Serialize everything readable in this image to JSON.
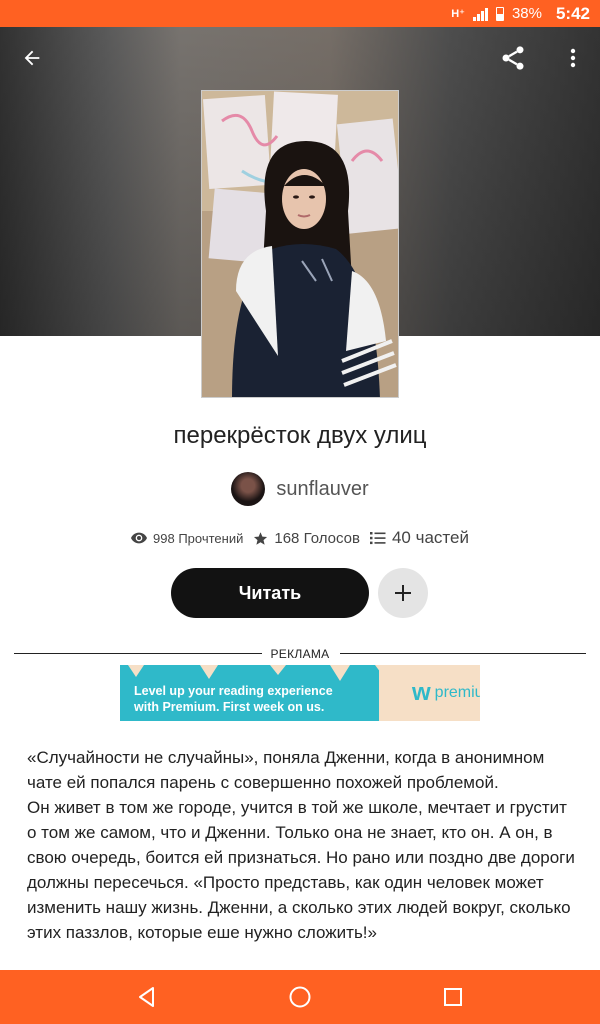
{
  "status_bar": {
    "network": "H⁺",
    "battery": "38%",
    "time": "5:42"
  },
  "story": {
    "title": "перекрёсток двух улиц",
    "author": "sunflauver",
    "reads": "998 Прочтений",
    "votes": "168 Голосов",
    "parts": "40 частей"
  },
  "actions": {
    "read_label": "Читать"
  },
  "ad": {
    "label": "РЕКЛАМА",
    "text_line1": "Level up your reading experience",
    "text_line2": "with Premium. First week on us.",
    "brand": "premium",
    "brand_mark": "w"
  },
  "description": {
    "p1": "«Случайности не случайны», поняла Дженни, когда в анонимном чате ей попался парень с совершенно похожей проблемой.",
    "p2": "Он живет в том же городе, учится в той же школе, мечтает и грустит о том же самом, что и Дженни. Только она не знает, кто он. А он, в свою очередь, боится ей признаться. Но рано или поздно две дороги должны пересечься. «Просто представь, как один человек может изменить нашу жизнь. Дженни, а сколько этих людей вокруг, сколько этих паззлов, которые еше нужно сложить!»"
  },
  "colors": {
    "accent": "#ff6122",
    "button_dark": "#121212",
    "ad_teal": "#2fb9c9"
  },
  "icons": [
    "back-arrow-icon",
    "share-icon",
    "more-vert-icon",
    "eye-icon",
    "star-icon",
    "list-icon",
    "plus-icon",
    "nav-back-icon",
    "nav-home-icon",
    "nav-recents-icon"
  ]
}
